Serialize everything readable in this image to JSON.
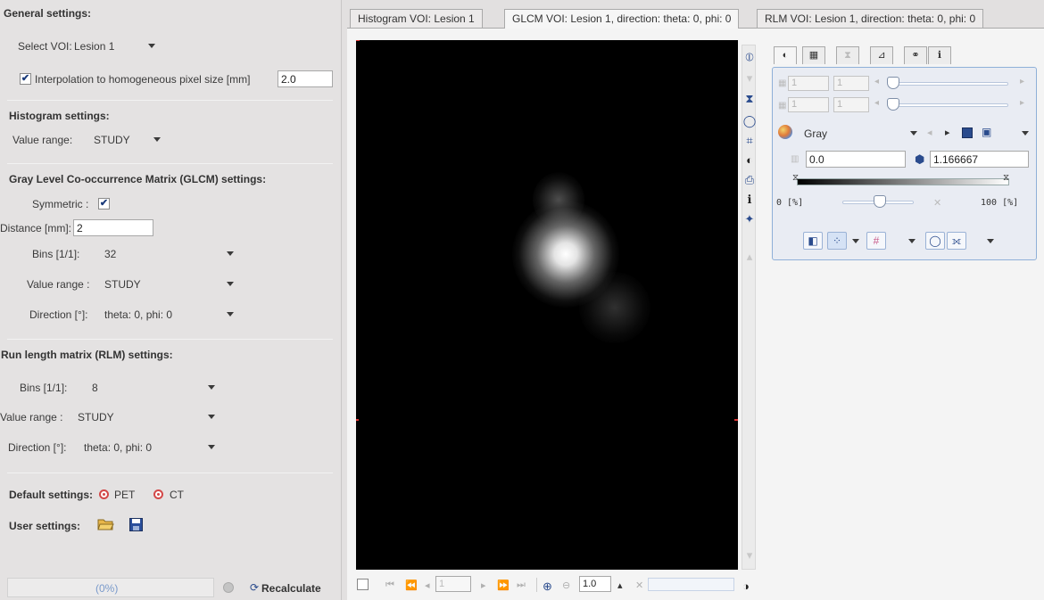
{
  "left": {
    "general_title": "General settings:",
    "select_voi_label": "Select VOI:",
    "select_voi_value": "Lesion 1",
    "interp_label": "Interpolation to homogeneous pixel size [mm]",
    "interp_value": "2.0",
    "histogram_title": "Histogram settings:",
    "hist_value_range_label": "Value range:",
    "hist_value_range_value": "STUDY",
    "glcm_title": "Gray Level Co-occurrence Matrix (GLCM) settings:",
    "symmetric_label": "Symmetric :",
    "distance_label": "Distance [mm]:",
    "distance_value": "2",
    "glcm_bins_label": "Bins [1/1]:",
    "glcm_bins_value": "32",
    "glcm_value_range_label": "Value range :",
    "glcm_value_range_value": "STUDY",
    "glcm_direction_label": "Direction [°]:",
    "glcm_direction_value": "theta: 0, phi: 0",
    "rlm_title": "Run length matrix (RLM) settings:",
    "rlm_bins_label": "Bins [1/1]:",
    "rlm_bins_value": "8",
    "rlm_value_range_label": "Value range :",
    "rlm_value_range_value": "STUDY",
    "rlm_direction_label": "Direction [°]:",
    "rlm_direction_value": "theta: 0, phi: 0",
    "default_settings_label": "Default settings:",
    "default_pet": "PET",
    "default_ct": "CT",
    "user_settings_label": "User settings:",
    "progress_text": "(0%)",
    "recalculate_label": "Recalculate"
  },
  "tabs": [
    "Histogram VOI: Lesion 1",
    "GLCM VOI: Lesion 1, direction: theta: 0, phi: 0",
    "RLM VOI: Lesion 1, direction: theta: 0, phi: 0"
  ],
  "viewer": {
    "page_value": "1",
    "zoom_value": "1.0"
  },
  "ctrl": {
    "field1a": "1",
    "field1b": "1",
    "field2a": "1",
    "field2b": "1",
    "colormap": "Gray",
    "min_value": "0.0",
    "max_value": "1.166667",
    "pct_left": "0 [%]",
    "pct_right": "100 [%]"
  }
}
